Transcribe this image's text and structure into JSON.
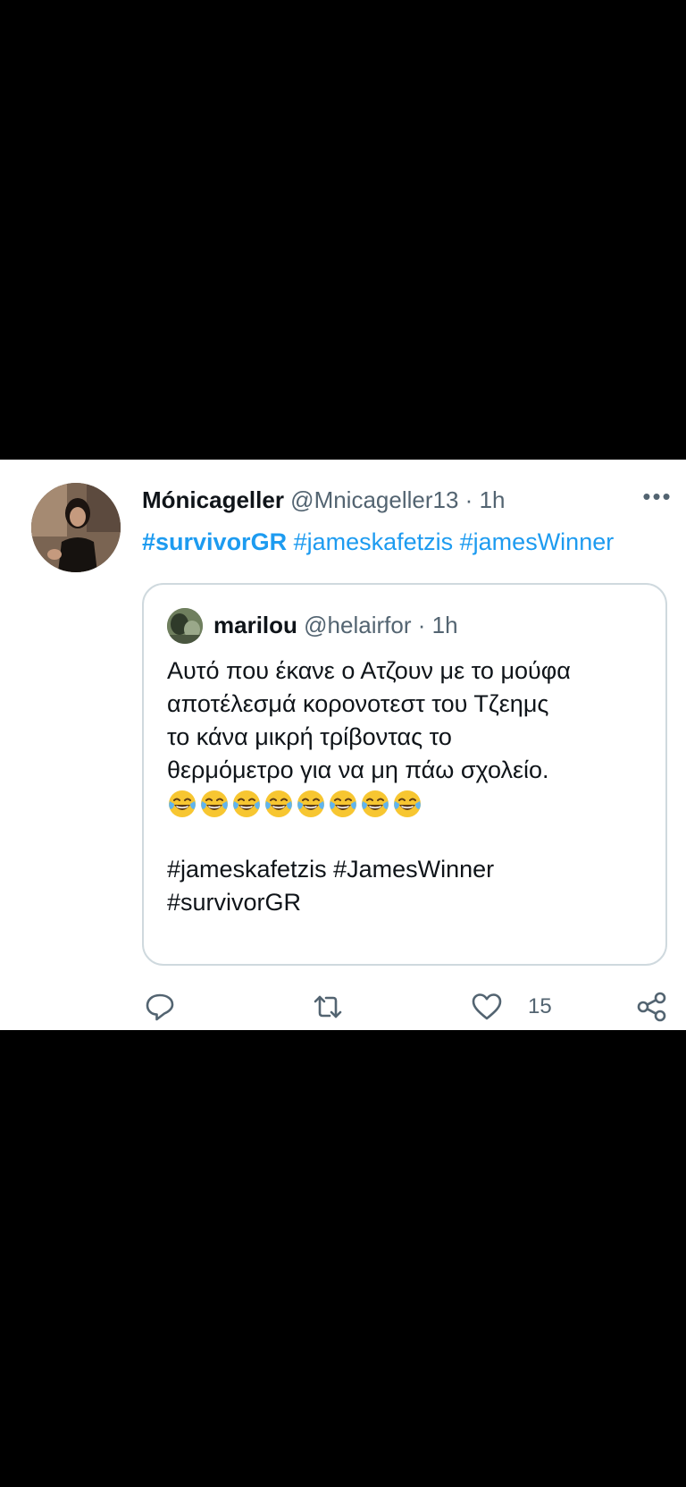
{
  "tweet": {
    "author": {
      "display_name": "Mónicageller",
      "handle": "@Mnicageller13",
      "separator": "·",
      "time": "1h"
    },
    "more_icon": "more-horizontal-icon",
    "hashtag_bold": "#survivorGR",
    "hashtag_rest": " #jameskafetzis #jamesWinner",
    "quote": {
      "display_name": "marilou",
      "handle": "@helairfor",
      "separator": "·",
      "time": "1h",
      "lines": [
        "Αυτό που έκανε ο Ατζουν με το μούφα",
        "αποτέλεσμά κορονοτεστ του Τζεημς",
        "το κάνα μικρή τρίβοντας το",
        "θερμόμετρο για να μη πάω σχολείο."
      ],
      "emoji": "face-with-tears-of-joy",
      "emoji_count": 8,
      "hashtag_line_1": "#jameskafetzis #JamesWinner",
      "hashtag_line_2": "#survivorGR"
    },
    "actions": {
      "reply_icon": "reply-icon",
      "retweet_icon": "retweet-icon",
      "like_icon": "heart-icon",
      "like_count": "15",
      "share_icon": "share-icon"
    },
    "colors": {
      "link": "#1d9bf0",
      "text": "#0f1419",
      "muted": "#536471",
      "border": "#cfd9de",
      "background": "#000000"
    }
  }
}
